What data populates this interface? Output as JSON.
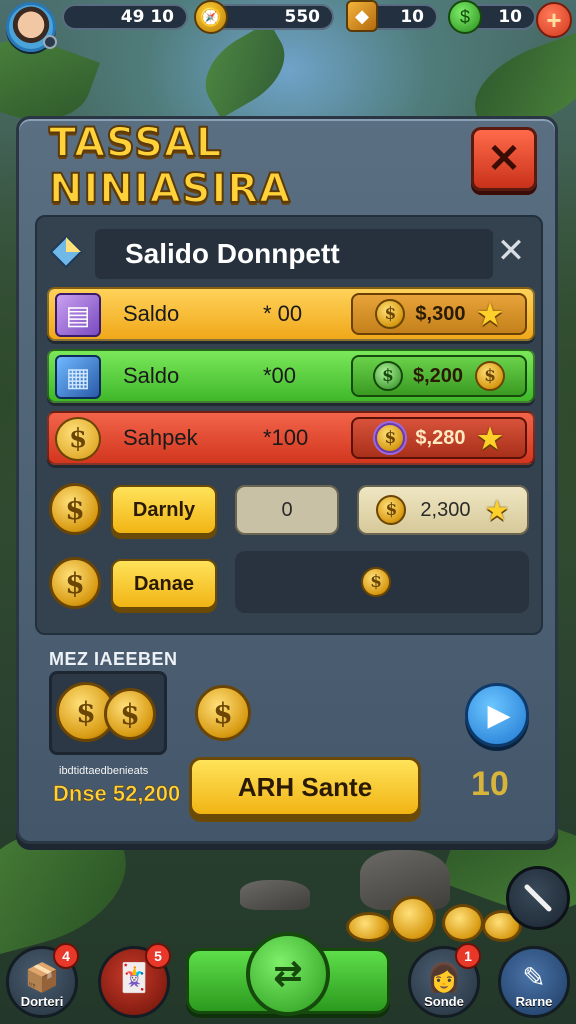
{
  "topbar": {
    "stat1_value": "49 10",
    "stat2_value": "550",
    "stat3_value": "10",
    "stat4_value": "10",
    "plus_label": "+"
  },
  "panel": {
    "title": "TASSAL NINIASIRA",
    "close_label": "✕",
    "header_text": "Salido Donnpett",
    "header_close_label": "✕"
  },
  "rows": [
    {
      "label": "Saldo",
      "amount": "* 00",
      "price": "$,300",
      "color": "#f5b52a"
    },
    {
      "label": "Saldo",
      "amount": "*00",
      "price": "$,200",
      "color": "#55d13a"
    },
    {
      "label": "Sahpek",
      "amount": "*100",
      "price": "$,280",
      "color": "#ea4a2a"
    }
  ],
  "row4": {
    "button_label": "Darnly",
    "box_value": "0",
    "price": "2,300"
  },
  "row5": {
    "button_label": "Danae"
  },
  "section": {
    "label": "MEZ IAEEBEN",
    "pack_subtitle": "ibdtidtaedbenieats",
    "pack_price": "Dnse 52,200",
    "main_button": "ARH Sante",
    "counter": "10"
  },
  "bottom_nav": [
    {
      "label": "Dorteri",
      "badge": "4"
    },
    {
      "label": "",
      "badge": "5"
    },
    {
      "label": "Sonde",
      "badge": "1"
    },
    {
      "label": "Rarne",
      "badge": ""
    }
  ],
  "colors": {
    "accent_gold": "#ffd23a",
    "panel_bg": "#5a6f82",
    "close_red": "#e8382a",
    "play_blue": "#1f77d1"
  }
}
